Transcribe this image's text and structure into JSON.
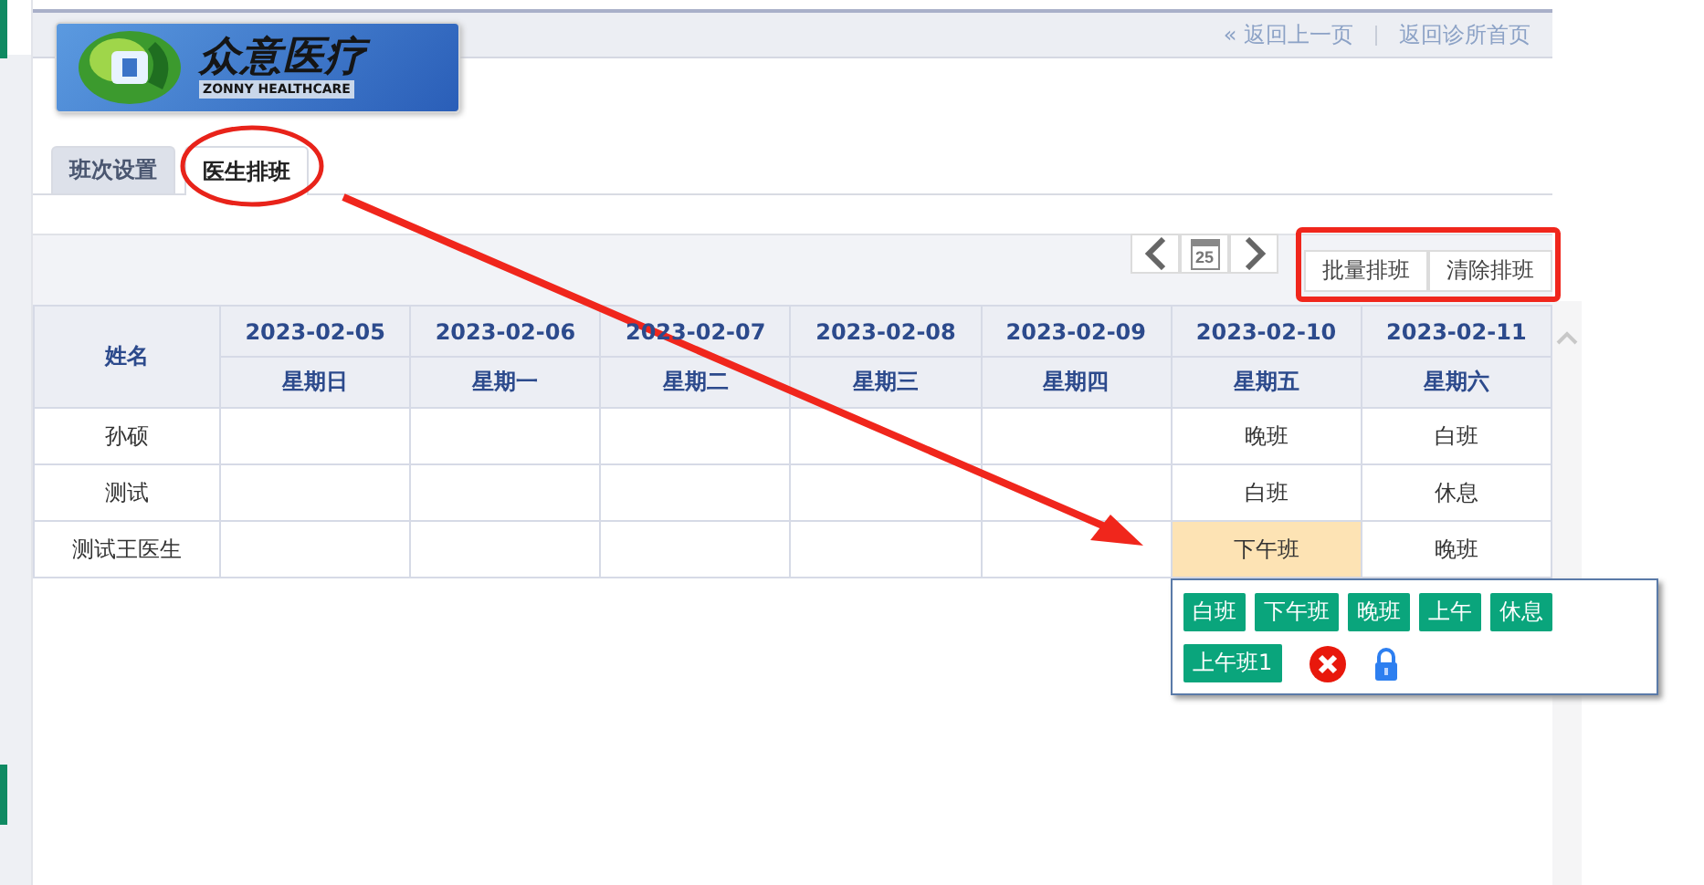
{
  "header": {
    "logo": {
      "title": "众意医疗",
      "subtitle": "ZONNY HEALTHCARE"
    },
    "links": [
      {
        "kind": "back",
        "icon": "«",
        "label": "返回上一页"
      },
      {
        "kind": "home",
        "label": "返回诊所首页"
      }
    ]
  },
  "tabs": [
    {
      "label": "班次设置",
      "selected": false
    },
    {
      "label": "医生排班",
      "selected": true
    }
  ],
  "toolbar": {
    "buttons": [
      "批量排班",
      "清除排班"
    ],
    "calendar_day": "25"
  },
  "table": {
    "name_column": "姓名",
    "days": [
      {
        "date": "2023-02-05",
        "weekday": "星期日"
      },
      {
        "date": "2023-02-06",
        "weekday": "星期一"
      },
      {
        "date": "2023-02-07",
        "weekday": "星期二"
      },
      {
        "date": "2023-02-08",
        "weekday": "星期三"
      },
      {
        "date": "2023-02-09",
        "weekday": "星期四"
      },
      {
        "date": "2023-02-10",
        "weekday": "星期五"
      },
      {
        "date": "2023-02-11",
        "weekday": "星期六"
      }
    ],
    "rows": [
      {
        "name": "孙硕",
        "cells": [
          {
            "selected": false
          },
          {
            "selected": false
          },
          {
            "selected": false
          },
          {
            "selected": false
          },
          {
            "selected": false
          },
          {
            "text": "晚班",
            "selected": false
          },
          {
            "text": "白班",
            "selected": false
          }
        ]
      },
      {
        "name": "测试",
        "cells": [
          {
            "selected": false
          },
          {
            "selected": false
          },
          {
            "selected": false
          },
          {
            "selected": false
          },
          {
            "selected": false
          },
          {
            "text": "白班",
            "selected": false
          },
          {
            "text": "休息",
            "selected": false
          }
        ]
      },
      {
        "name": "测试王医生",
        "cells": [
          {
            "selected": false
          },
          {
            "selected": false
          },
          {
            "selected": false
          },
          {
            "selected": false
          },
          {
            "selected": false
          },
          {
            "text": "下午班",
            "selected": true
          },
          {
            "text": "晚班",
            "selected": false
          }
        ]
      }
    ]
  },
  "shift_picker": {
    "options": [
      "白班",
      "下午班",
      "晚班",
      "上午",
      "休息",
      "上午班1"
    ],
    "actions": [
      {
        "kind": "clear"
      },
      {
        "kind": "lock"
      }
    ]
  },
  "annotations": [
    {
      "kind": "ellipse"
    },
    {
      "kind": "arrow"
    },
    {
      "kind": "frame"
    }
  ]
}
